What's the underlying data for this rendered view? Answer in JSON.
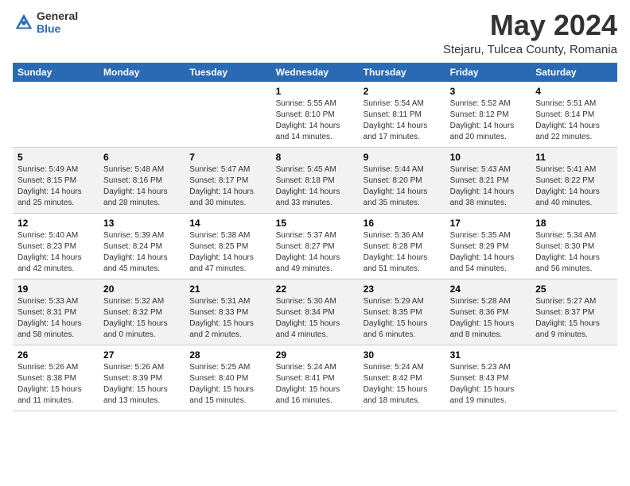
{
  "header": {
    "logo_general": "General",
    "logo_blue": "Blue",
    "month_title": "May 2024",
    "location": "Stejaru, Tulcea County, Romania"
  },
  "weekdays": [
    "Sunday",
    "Monday",
    "Tuesday",
    "Wednesday",
    "Thursday",
    "Friday",
    "Saturday"
  ],
  "weeks": [
    [
      {
        "day": "",
        "info": ""
      },
      {
        "day": "",
        "info": ""
      },
      {
        "day": "",
        "info": ""
      },
      {
        "day": "1",
        "info": "Sunrise: 5:55 AM\nSunset: 8:10 PM\nDaylight: 14 hours\nand 14 minutes."
      },
      {
        "day": "2",
        "info": "Sunrise: 5:54 AM\nSunset: 8:11 PM\nDaylight: 14 hours\nand 17 minutes."
      },
      {
        "day": "3",
        "info": "Sunrise: 5:52 AM\nSunset: 8:12 PM\nDaylight: 14 hours\nand 20 minutes."
      },
      {
        "day": "4",
        "info": "Sunrise: 5:51 AM\nSunset: 8:14 PM\nDaylight: 14 hours\nand 22 minutes."
      }
    ],
    [
      {
        "day": "5",
        "info": "Sunrise: 5:49 AM\nSunset: 8:15 PM\nDaylight: 14 hours\nand 25 minutes."
      },
      {
        "day": "6",
        "info": "Sunrise: 5:48 AM\nSunset: 8:16 PM\nDaylight: 14 hours\nand 28 minutes."
      },
      {
        "day": "7",
        "info": "Sunrise: 5:47 AM\nSunset: 8:17 PM\nDaylight: 14 hours\nand 30 minutes."
      },
      {
        "day": "8",
        "info": "Sunrise: 5:45 AM\nSunset: 8:18 PM\nDaylight: 14 hours\nand 33 minutes."
      },
      {
        "day": "9",
        "info": "Sunrise: 5:44 AM\nSunset: 8:20 PM\nDaylight: 14 hours\nand 35 minutes."
      },
      {
        "day": "10",
        "info": "Sunrise: 5:43 AM\nSunset: 8:21 PM\nDaylight: 14 hours\nand 38 minutes."
      },
      {
        "day": "11",
        "info": "Sunrise: 5:41 AM\nSunset: 8:22 PM\nDaylight: 14 hours\nand 40 minutes."
      }
    ],
    [
      {
        "day": "12",
        "info": "Sunrise: 5:40 AM\nSunset: 8:23 PM\nDaylight: 14 hours\nand 42 minutes."
      },
      {
        "day": "13",
        "info": "Sunrise: 5:39 AM\nSunset: 8:24 PM\nDaylight: 14 hours\nand 45 minutes."
      },
      {
        "day": "14",
        "info": "Sunrise: 5:38 AM\nSunset: 8:25 PM\nDaylight: 14 hours\nand 47 minutes."
      },
      {
        "day": "15",
        "info": "Sunrise: 5:37 AM\nSunset: 8:27 PM\nDaylight: 14 hours\nand 49 minutes."
      },
      {
        "day": "16",
        "info": "Sunrise: 5:36 AM\nSunset: 8:28 PM\nDaylight: 14 hours\nand 51 minutes."
      },
      {
        "day": "17",
        "info": "Sunrise: 5:35 AM\nSunset: 8:29 PM\nDaylight: 14 hours\nand 54 minutes."
      },
      {
        "day": "18",
        "info": "Sunrise: 5:34 AM\nSunset: 8:30 PM\nDaylight: 14 hours\nand 56 minutes."
      }
    ],
    [
      {
        "day": "19",
        "info": "Sunrise: 5:33 AM\nSunset: 8:31 PM\nDaylight: 14 hours\nand 58 minutes."
      },
      {
        "day": "20",
        "info": "Sunrise: 5:32 AM\nSunset: 8:32 PM\nDaylight: 15 hours\nand 0 minutes."
      },
      {
        "day": "21",
        "info": "Sunrise: 5:31 AM\nSunset: 8:33 PM\nDaylight: 15 hours\nand 2 minutes."
      },
      {
        "day": "22",
        "info": "Sunrise: 5:30 AM\nSunset: 8:34 PM\nDaylight: 15 hours\nand 4 minutes."
      },
      {
        "day": "23",
        "info": "Sunrise: 5:29 AM\nSunset: 8:35 PM\nDaylight: 15 hours\nand 6 minutes."
      },
      {
        "day": "24",
        "info": "Sunrise: 5:28 AM\nSunset: 8:36 PM\nDaylight: 15 hours\nand 8 minutes."
      },
      {
        "day": "25",
        "info": "Sunrise: 5:27 AM\nSunset: 8:37 PM\nDaylight: 15 hours\nand 9 minutes."
      }
    ],
    [
      {
        "day": "26",
        "info": "Sunrise: 5:26 AM\nSunset: 8:38 PM\nDaylight: 15 hours\nand 11 minutes."
      },
      {
        "day": "27",
        "info": "Sunrise: 5:26 AM\nSunset: 8:39 PM\nDaylight: 15 hours\nand 13 minutes."
      },
      {
        "day": "28",
        "info": "Sunrise: 5:25 AM\nSunset: 8:40 PM\nDaylight: 15 hours\nand 15 minutes."
      },
      {
        "day": "29",
        "info": "Sunrise: 5:24 AM\nSunset: 8:41 PM\nDaylight: 15 hours\nand 16 minutes."
      },
      {
        "day": "30",
        "info": "Sunrise: 5:24 AM\nSunset: 8:42 PM\nDaylight: 15 hours\nand 18 minutes."
      },
      {
        "day": "31",
        "info": "Sunrise: 5:23 AM\nSunset: 8:43 PM\nDaylight: 15 hours\nand 19 minutes."
      },
      {
        "day": "",
        "info": ""
      }
    ]
  ]
}
